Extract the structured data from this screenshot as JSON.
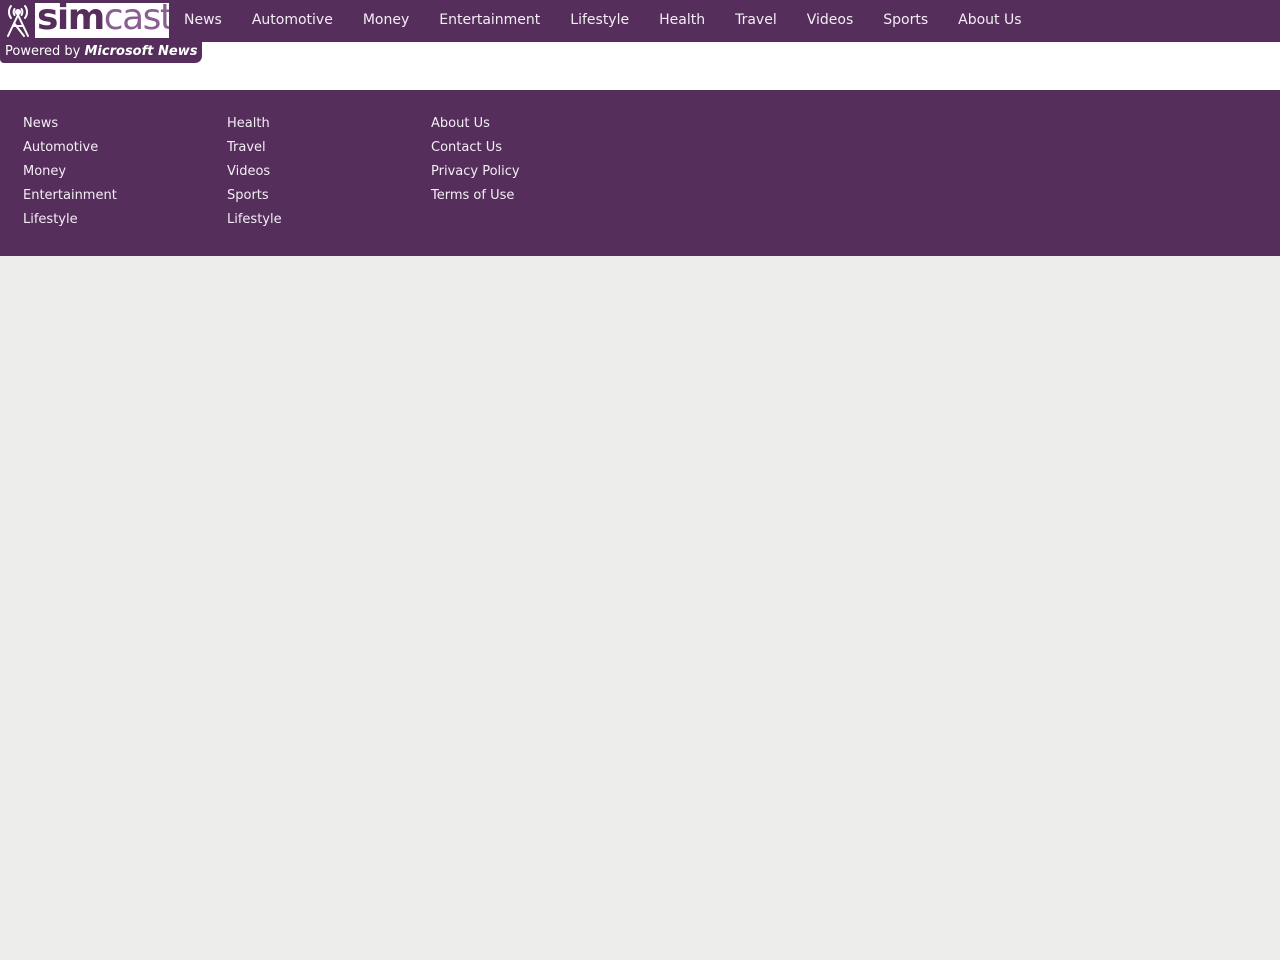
{
  "brand": {
    "logo_part_a": "sim",
    "logo_part_b": "cast",
    "logo_icon": "radio-tower-icon",
    "powered_by_prefix": "Powered by",
    "powered_by_brand": "Microsoft News",
    "colors": {
      "primary": "#552e5b",
      "logo_light": "#8a5e90",
      "page_background": "#ededec"
    }
  },
  "nav": {
    "items": [
      {
        "label": "News"
      },
      {
        "label": "Automotive"
      },
      {
        "label": "Money"
      },
      {
        "label": "Entertainment"
      },
      {
        "label": "Lifestyle"
      },
      {
        "label": "Health"
      },
      {
        "label": "Travel"
      },
      {
        "label": "Videos"
      },
      {
        "label": "Sports"
      },
      {
        "label": "About Us"
      }
    ]
  },
  "footer": {
    "columns": [
      {
        "links": [
          "News",
          "Automotive",
          "Money",
          "Entertainment",
          "Lifestyle"
        ]
      },
      {
        "links": [
          "Health",
          "Travel",
          "Videos",
          "Sports",
          "Lifestyle"
        ]
      },
      {
        "links": [
          "About Us",
          "Contact Us",
          "Privacy Policy",
          "Terms of Use"
        ]
      }
    ]
  }
}
